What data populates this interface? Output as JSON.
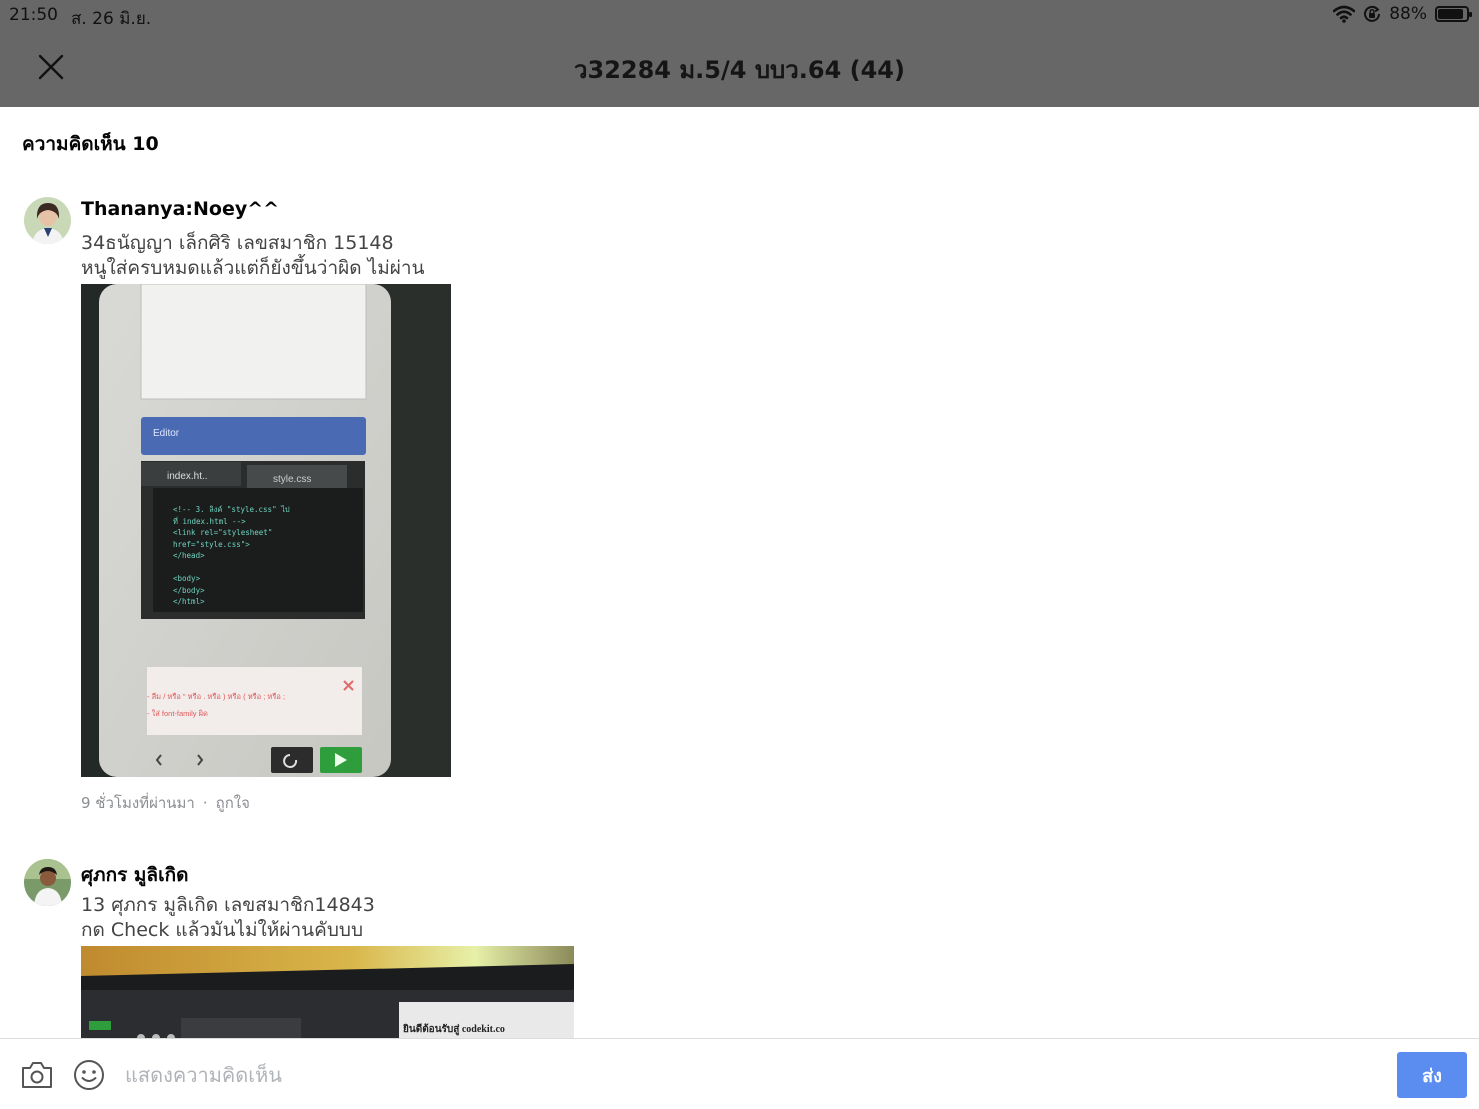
{
  "status_bar": {
    "time": "21:50",
    "date": "ส. 26 มิ.ย.",
    "battery_percent": "88%",
    "battery_level": 0.88,
    "icons": [
      "wifi-icon",
      "orientation-lock-icon",
      "battery-icon"
    ]
  },
  "header": {
    "title": "ว32284 ม.5/4 บบว.64 (44)",
    "close_icon": "close-icon"
  },
  "comments_section": {
    "count_label": "ความคิดเห็น 10"
  },
  "comments": [
    {
      "name": "Thananya:Noey^^",
      "line1": "34ธนัญญา เล็กศิริ เลขสมาชิก 15148",
      "line2": "หนูใส่ครบหมดแล้วแต่ก็ยังขึ้นว่าผิด ไม่ผ่าน",
      "time": "9 ชั่วโมงที่ผ่านมา",
      "separator": "·",
      "like_label": "ถูกใจ",
      "photo": {
        "editor_label": "Editor",
        "tab1": "index.ht..",
        "tab2": "style.css",
        "code_lines": [
          "<!-- 3. ลิงค์ \"style.css\" ไป",
          "ที่ index.html -->",
          "<link rel=\"stylesheet\"",
          "href=\"style.css\">",
          "</head>",
          "",
          "<body>",
          "</body>",
          "</html>"
        ],
        "error_line1": "- ลืม / หรือ \" หรือ . หรือ ) หรือ ( หรือ ; หรือ ;",
        "error_line2": "- ใส่ font-family ผิด"
      }
    },
    {
      "name": "ศุภกร มูลิเกิด",
      "line1": "13 ศุภกร มูลิเกิด เลขสมาชิก14843",
      "line2": "กด Check แล้วมันไม่ให้ผ่านคับบบ",
      "photo": {
        "banner_text": "ยินดีต้อนรับสู่ codekit.co"
      }
    }
  ],
  "composer": {
    "placeholder": "แสดงความคิดเห็น",
    "send_label": "ส่ง",
    "camera_icon": "camera-icon",
    "emoji_icon": "emoji-icon",
    "accent_color": "#5b8df0"
  }
}
